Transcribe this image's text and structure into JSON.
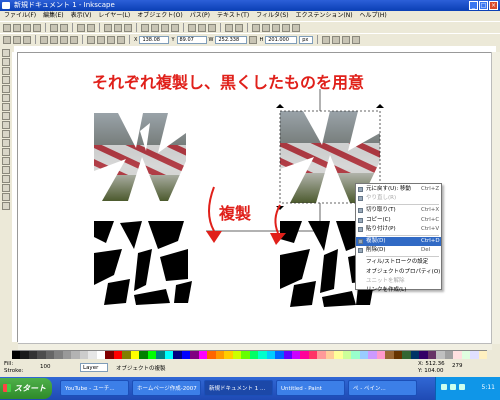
{
  "window": {
    "title": "新規ドキュメント 1 - Inkscape"
  },
  "menu": [
    "ファイル(F)",
    "編集(E)",
    "表示(V)",
    "レイヤー(L)",
    "オブジェクト(O)",
    "パス(P)",
    "テキスト(T)",
    "フィルタ(S)",
    "エクステンション(N)",
    "ヘルプ(H)"
  ],
  "toolbar": {
    "x_value": "138.08",
    "y_value": "89.07",
    "w_value": "252.338",
    "h_value": "201.000",
    "unit": "px"
  },
  "canvas": {
    "heading": "それぞれ複製し、黒くしたものを用意",
    "dup_label": "複製"
  },
  "context_menu": [
    {
      "label": "元に戻す(U): 移動",
      "shortcut": "Ctrl+Z",
      "disabled": false
    },
    {
      "label": "やり直し(R)",
      "shortcut": "",
      "disabled": true
    },
    {
      "sep": true
    },
    {
      "label": "切り取り(T)",
      "shortcut": "Ctrl+X",
      "disabled": false
    },
    {
      "label": "コピー(C)",
      "shortcut": "Ctrl+C",
      "disabled": false
    },
    {
      "label": "貼り付け(P)",
      "shortcut": "Ctrl+V",
      "disabled": false
    },
    {
      "sep": true
    },
    {
      "label": "複製(D)",
      "shortcut": "Ctrl+D",
      "disabled": false,
      "highlight": true
    },
    {
      "label": "削除(D)",
      "shortcut": "Del",
      "disabled": false
    },
    {
      "sep": true
    },
    {
      "label": "フィル/ストロークの設定",
      "shortcut": "",
      "disabled": false
    },
    {
      "label": "オブジェクトのプロパティ(O)",
      "shortcut": "",
      "disabled": false
    },
    {
      "label": "ユニットを解除",
      "shortcut": "",
      "disabled": true
    },
    {
      "label": "リンクを作成(L)",
      "shortcut": "",
      "disabled": false
    }
  ],
  "palette": [
    "#000000",
    "#1a1a1a",
    "#333333",
    "#4d4d4d",
    "#666666",
    "#808080",
    "#999999",
    "#b3b3b3",
    "#cccccc",
    "#e6e6e6",
    "#ffffff",
    "#800000",
    "#ff0000",
    "#808000",
    "#ffff00",
    "#008000",
    "#00ff00",
    "#008080",
    "#00ffff",
    "#000080",
    "#0000ff",
    "#800080",
    "#ff00ff",
    "#ff6600",
    "#ff9900",
    "#ffcc00",
    "#ccff00",
    "#66ff00",
    "#00ff66",
    "#00ffcc",
    "#00ccff",
    "#0066ff",
    "#6600ff",
    "#cc00ff",
    "#ff0099",
    "#ff3366",
    "#ff9999",
    "#ffcc99",
    "#ffff99",
    "#ccff99",
    "#99ffcc",
    "#99ccff",
    "#cc99ff",
    "#ff99cc",
    "#996633",
    "#663300",
    "#336633",
    "#003366",
    "#330066",
    "#663366",
    "#c0c0c0",
    "#a0a0a0",
    "#ffe0e0",
    "#e0ffe0",
    "#e0e0ff",
    "#fff0c0"
  ],
  "status": {
    "fill_label": "Fill:",
    "stroke_label": "Stroke:",
    "opacity": "100",
    "layer": "Layer",
    "message": "オブジェクトの複製",
    "x": "X: 512.36",
    "y": "Y: 104.00",
    "zoom": "279"
  },
  "taskbar": {
    "start": "スタート",
    "tasks": [
      "YouTube - ユーチ...",
      "ホームページ作成-2007",
      "新規ドキュメント 1 ...",
      "Untitled - Paint",
      "ぺ - ペイン..."
    ],
    "clock": "5:11"
  },
  "colors": {
    "accent_red": "#e0201a",
    "highlight": "#316ac5"
  }
}
